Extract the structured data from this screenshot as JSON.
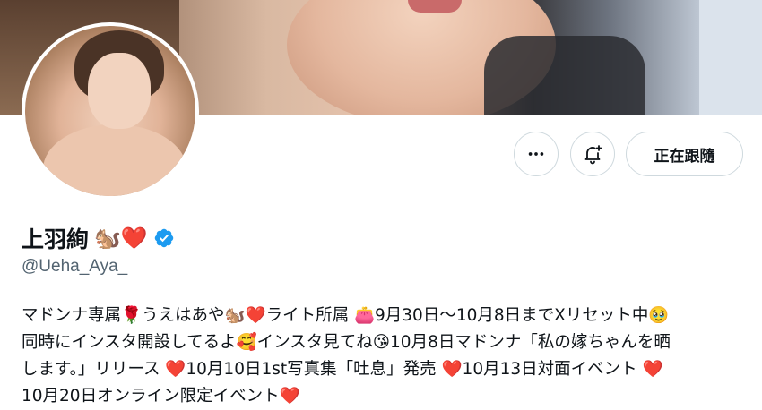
{
  "profile": {
    "name": "上羽絢",
    "name_emojis": "🐿️❤️",
    "handle": "@Ueha_Aya_",
    "verified": true,
    "verified_color": "#1d9bf0"
  },
  "actions": {
    "more_icon": "ellipsis-icon",
    "notify_icon": "bell-plus-icon",
    "follow_label": "正在跟隨"
  },
  "bio": {
    "lines": [
      "マドンナ専属🌹うえはあや🐿️❤️ライト所属 👛9月30日〜10月8日までXリセット中🥹",
      "同時にインスタ開設してるよ🥰インスタ見てね😘10月8日マドンナ「私の嫁ちゃんを晒",
      "します。」リリース ❤️10月10日1st写真集「吐息」発売 ❤️10月13日対面イベント ❤️",
      "10月20日オンライン限定イベント❤️"
    ]
  }
}
